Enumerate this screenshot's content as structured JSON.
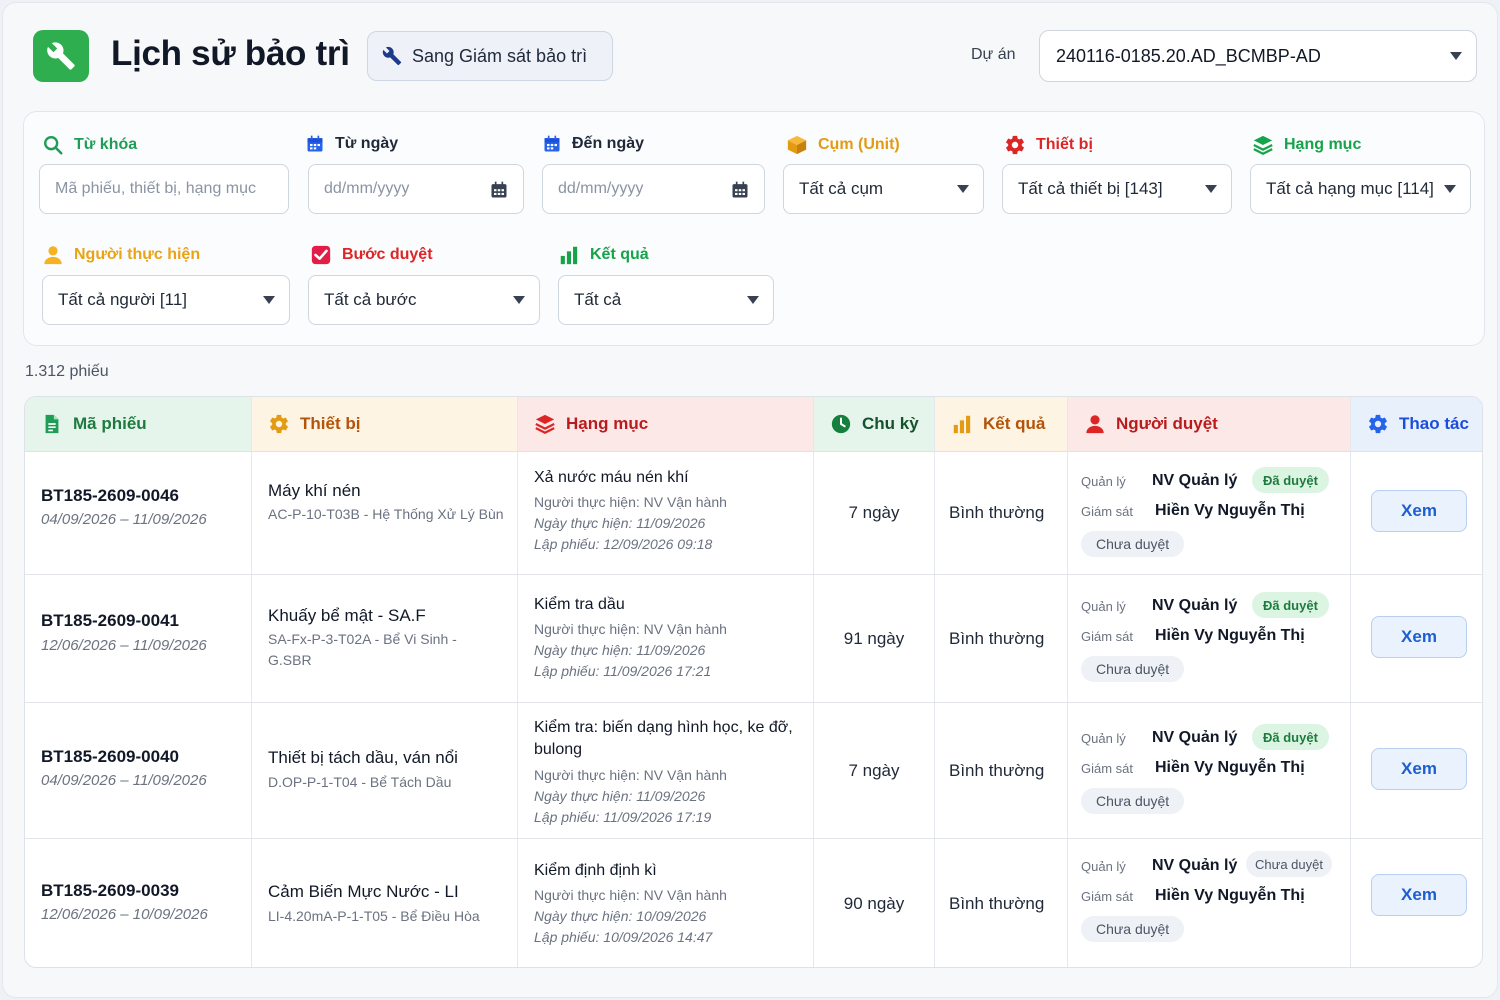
{
  "header": {
    "title": "Lịch sử bảo trì",
    "switch_button": "Sang Giám sát bảo trì",
    "project_label": "Dự án",
    "project_value": "240116-0185.20.AD_BCMBP-AD"
  },
  "filters": {
    "keyword": {
      "label": "Từ khóa",
      "placeholder": "Mã phiếu, thiết bị, hạng mục",
      "color": "#1f9d57"
    },
    "from_date": {
      "label": "Từ ngày",
      "placeholder": "dd/mm/yyyy",
      "color": "#2563eb"
    },
    "to_date": {
      "label": "Đến ngày",
      "placeholder": "dd/mm/yyyy",
      "color": "#2563eb"
    },
    "unit": {
      "label": "Cụm (Unit)",
      "value": "Tất cả cụm",
      "color": "#e39b14"
    },
    "device": {
      "label": "Thiết bị",
      "value": "Tất cả thiết bị [143]",
      "color": "#dc2626"
    },
    "category": {
      "label": "Hạng mục",
      "value": "Tất cả hạng mục [114]",
      "color": "#16a34a"
    },
    "performer": {
      "label": "Người thực hiện",
      "value": "Tất cả người [11]",
      "color": "#e8a317"
    },
    "approval_step": {
      "label": "Bước duyệt",
      "value": "Tất cả bước",
      "color": "#dc2626"
    },
    "result": {
      "label": "Kết quả",
      "value": "Tất cả",
      "color": "#16a34a"
    }
  },
  "count_text": "1.312 phiếu",
  "table": {
    "headers": {
      "code": "Mã phiếu",
      "device": "Thiết bị",
      "category": "Hạng mục",
      "cycle": "Chu kỳ",
      "result": "Kết quả",
      "approver": "Người duyệt",
      "action": "Thao tác"
    },
    "header_colors": {
      "code": "#1f9d57",
      "device": "#d97706",
      "category": "#dc2626",
      "cycle": "#15803d",
      "result": "#d97706",
      "approver": "#dc2626",
      "action": "#2563eb"
    },
    "role_manager": "Quản lý",
    "role_supervisor": "Giám sát",
    "view_label": "Xem",
    "rows": [
      {
        "code": "BT185-2609-0046",
        "range": "04/09/2026 – 11/09/2026",
        "device_name": "Máy khí nén",
        "device_loc": "AC-P-10-T03B - Hệ Thống Xử Lý Bùn",
        "item_title": "Xả nước máu nén khí",
        "performer": "Người thực hiện: NV Vận hành",
        "done_date": "Ngày thực hiện: 11/09/2026",
        "created": "Lập phiếu: 12/09/2026 09:18",
        "cycle": "7 ngày",
        "result": "Bình thường",
        "manager": "NV Quản lý",
        "manager_status": "Đã duyệt",
        "supervisor": "Hiền Vy Nguyễn Thị",
        "supervisor_status": "Chưa duyệt"
      },
      {
        "code": "BT185-2609-0041",
        "range": "12/06/2026 – 11/09/2026",
        "device_name": "Khuấy bể mật - SA.F",
        "device_loc": "SA-Fx-P-3-T02A - Bể Vi Sinh - G.SBR",
        "item_title": "Kiểm tra dầu",
        "performer": "Người thực hiện: NV Vận hành",
        "done_date": "Ngày thực hiện: 11/09/2026",
        "created": "Lập phiếu: 11/09/2026 17:21",
        "cycle": "91 ngày",
        "result": "Bình thường",
        "manager": "NV Quản lý",
        "manager_status": "Đã duyệt",
        "supervisor": "Hiền Vy Nguyễn Thị",
        "supervisor_status": "Chưa duyệt"
      },
      {
        "code": "BT185-2609-0040",
        "range": "04/09/2026 – 11/09/2026",
        "device_name": "Thiết bị tách dầu, ván nổi",
        "device_loc": "D.OP-P-1-T04 - Bể Tách Dầu",
        "item_title": "Kiểm tra: biến dạng hình học, ke đỡ, bulong",
        "performer": "Người thực hiện: NV Vận hành",
        "done_date": "Ngày thực hiện: 11/09/2026",
        "created": "Lập phiếu: 11/09/2026 17:19",
        "cycle": "7 ngày",
        "result": "Bình thường",
        "manager": "NV Quản lý",
        "manager_status": "Đã duyệt",
        "supervisor": "Hiền Vy Nguyễn Thị",
        "supervisor_status": "Chưa duyệt"
      },
      {
        "code": "BT185-2609-0039",
        "range": "12/06/2026 – 10/09/2026",
        "device_name": "Cảm Biến Mực Nước - LI",
        "device_loc": "LI-4.20mA-P-1-T05 - Bể Điều Hòa",
        "item_title": "Kiểm định định kì",
        "performer": "Người thực hiện: NV Vận hành",
        "done_date": "Ngày thực hiện: 10/09/2026",
        "created": "Lập phiếu: 10/09/2026 14:47",
        "cycle": "90 ngày",
        "result": "Bình thường",
        "manager": "NV Quản lý",
        "manager_status": "Chưa duyệt",
        "supervisor": "Hiền Vy Nguyễn Thị",
        "supervisor_status": "Chưa duyệt"
      }
    ]
  }
}
